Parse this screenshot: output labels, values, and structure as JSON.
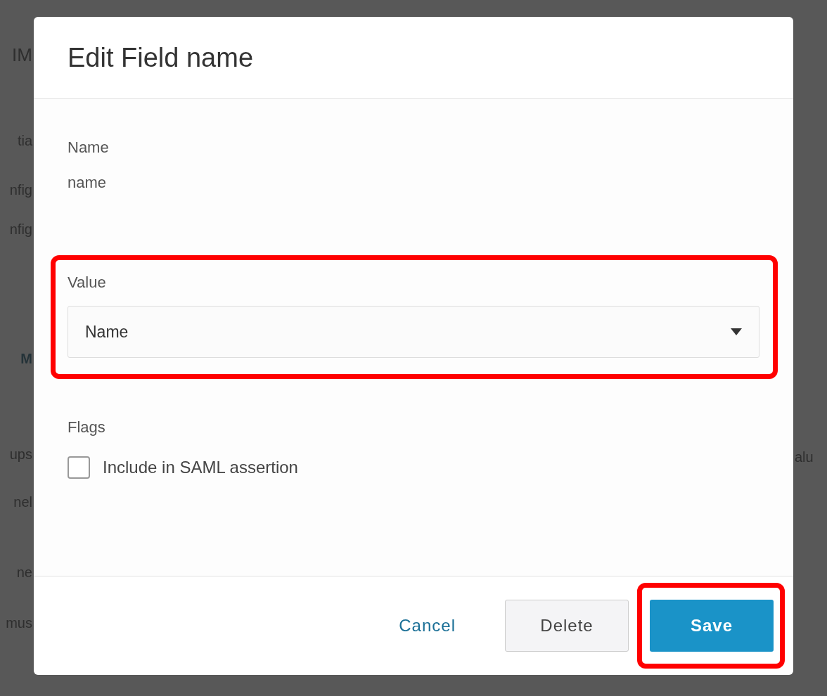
{
  "background": {
    "left_fragments": [
      {
        "text": "IM",
        "bold": false
      },
      {
        "text": "tia",
        "bold": false
      },
      {
        "text": "nfig",
        "bold": false
      },
      {
        "text": "nfig",
        "bold": false
      },
      {
        "text": "M",
        "bold": true
      },
      {
        "text": "ups",
        "bold": false
      },
      {
        "text": "nel",
        "bold": false
      },
      {
        "text": "ne",
        "bold": false
      },
      {
        "text": "mus",
        "bold": false
      }
    ],
    "right_fragments": [
      {
        "text": "alu"
      }
    ]
  },
  "dialog": {
    "title": "Edit Field name",
    "name": {
      "label": "Name",
      "value": "name"
    },
    "value_field": {
      "label": "Value",
      "value": "Name",
      "highlighted": true
    },
    "flags": {
      "label": "Flags",
      "options": [
        {
          "label": "Include in SAML assertion",
          "checked": false
        }
      ]
    },
    "buttons": [
      {
        "kind": "link",
        "label": "Cancel",
        "highlighted": false
      },
      {
        "kind": "secondary",
        "label": "Delete",
        "highlighted": false
      },
      {
        "kind": "primary",
        "label": "Save",
        "highlighted": true
      }
    ]
  }
}
